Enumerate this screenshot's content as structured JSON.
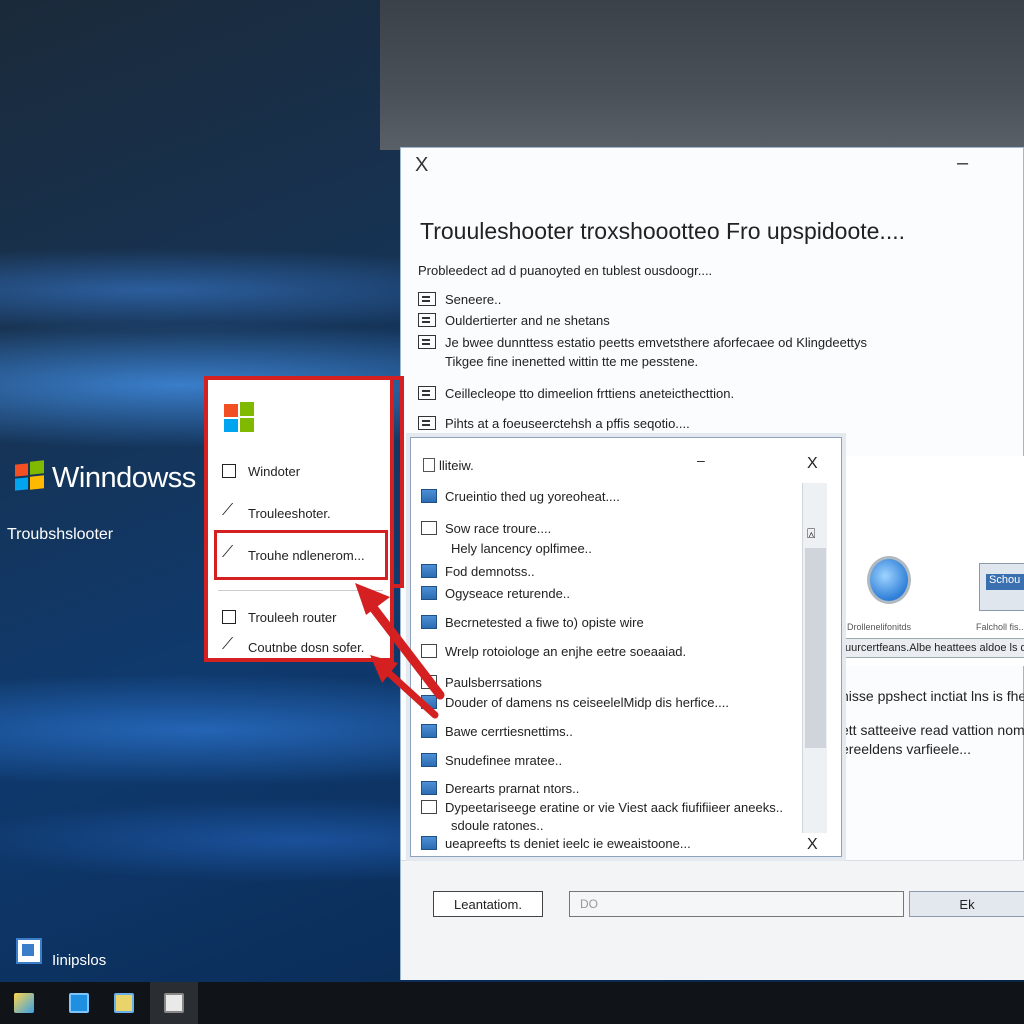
{
  "desktop": {
    "brand_title": "Winndowss",
    "subtitle": "Troubshslooter",
    "icon_label": "Iinipslos"
  },
  "main_dialog": {
    "close_icon": "X",
    "minimize_icon": "–",
    "title": "Trouuleshooter troxshoootteo Fro upspidoote....",
    "subtitle": "Probleedect ad d puanoyted en tublest ousdoogr....",
    "items": [
      "Seneere..",
      "Ouldertierter and ne shetans",
      "Je bwee dunnttess estatio peetts emvetsthere aforfecaee od Klingdeettys",
      "Tikgee fine inenetted wittin tte me pesstene.",
      "Ceillecleope tto dimeelion frttiens aneteicthecttion.",
      "Pihts at a foeuseerctehsh a pffis seqotio...."
    ],
    "caption_left": "Drollenelifonitds",
    "caption_right": "Falcholl fis...",
    "caption_bar": "uurcertfeans.Albe heattees aldoe ls d tfcctatie",
    "paragraphs": [
      "nisse ppshect inctiat lns is fhestet",
      "ett satteeive read vattion nom dee",
      "ereeldens varfieele..."
    ],
    "mini_window_label": "Schou",
    "buttons": {
      "left": "Leantatiom.",
      "field": "DO",
      "ok": "Ek"
    }
  },
  "inner_dialog": {
    "title": "lliteiw.",
    "minimize_icon": "–",
    "close_icon": "X",
    "scroll_icon": "⍓",
    "items": [
      "Crueintio thed ug yoreoheat....",
      "Sow race troure....",
      "Hely lancency oplfimee..",
      "Fod demnotss..",
      "Ogyseace returende..",
      "Becrnetested a fiwe to) opiste wire",
      "Wrelp rotoiologe an enjhe eetre soeaaiad.",
      "Paulsberrsations",
      "Douder of damens ns ceiseelelMidp dis herfice....",
      "Bawe cerrtiesnettims..",
      "Snudefinee mratee..",
      "Derearts prarnat ntors..",
      "Dypeetariseege eratine or vie Viest aack fiufifiieer aneeks..",
      "sdoule ratones..",
      "ueapreefts ts deniet ieelc ie eweaistoone..."
    ]
  },
  "menu_panel": {
    "items": [
      "Windoter",
      "Trouleeshoter.",
      "Trouhe ndlenerom...",
      "Trouleeh router",
      "Coutnbe dosn sofer."
    ]
  },
  "colors": {
    "highlight_red": "#d42020",
    "accent_blue": "#2b6cb3"
  }
}
